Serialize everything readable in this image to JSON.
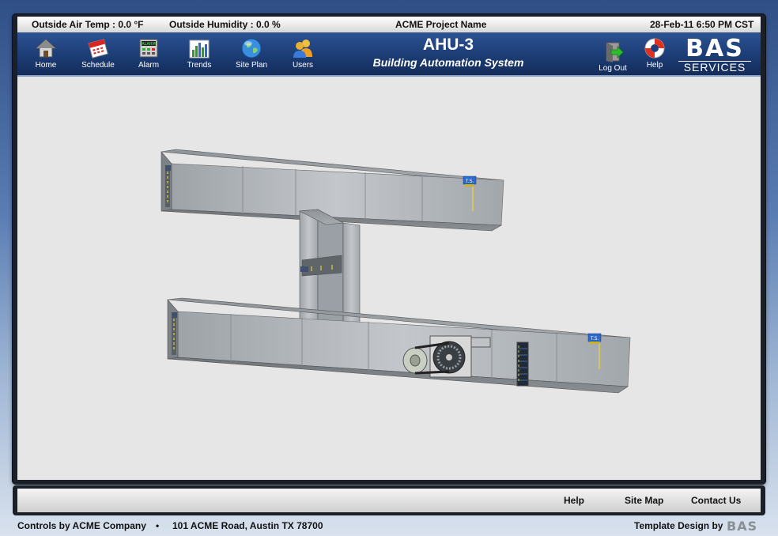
{
  "status": {
    "air_temp": "Outside Air Temp : 0.0 °F",
    "humidity": "Outside Humidity : 0.0 %",
    "project": "ACME Project Name",
    "datetime": "28-Feb-11 6:50 PM CST"
  },
  "nav": {
    "home": "Home",
    "schedule": "Schedule",
    "alarm": "Alarm",
    "trends": "Trends",
    "site_plan": "Site Plan",
    "users": "Users",
    "log_out": "Log Out",
    "help": "Help"
  },
  "title": {
    "main": "AHU-3",
    "sub": "Building Automation System"
  },
  "logo": {
    "top": "BAS",
    "bottom": "SERVICES"
  },
  "diagram": {
    "ts_label": "T.S.",
    "alarm_label": "ALARM"
  },
  "footer": {
    "help": "Help",
    "site_map": "Site Map",
    "contact": "Contact Us"
  },
  "bottom": {
    "controls": "Controls by ACME Company",
    "bullet": "•",
    "address": "101 ACME Road, Austin TX 78700",
    "template": "Template Design by",
    "template_logo": "BAS"
  },
  "colors": {
    "nav_bg": "#1d3e78",
    "canvas_bg": "#e6e6e6",
    "duct": "#b4b8bc"
  }
}
